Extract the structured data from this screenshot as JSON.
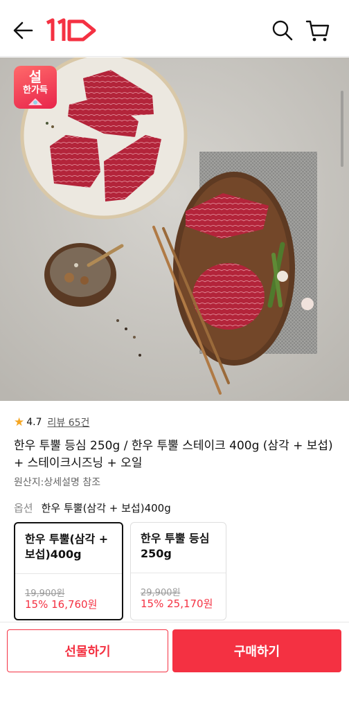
{
  "header": {
    "back_icon": "arrow-left-icon",
    "logo_text": "11",
    "search_icon": "search-icon",
    "cart_icon": "cart-icon",
    "brand_color": "#f43142"
  },
  "product_image": {
    "promo_badge_line1": "설",
    "promo_badge_line2": "한가득"
  },
  "product": {
    "rating": "4.7",
    "review_link": "리뷰 65건",
    "title": "한우 투뿔 등심 250g / 한우 투뿔 스테이크 400g (삼각 + 보섭) + 스테이크시즈닝 + 오일",
    "origin": "원산지:상세설명 참조"
  },
  "options": {
    "label": "옵션",
    "selected_value": "한우 투뿔(삼각 + 보섭)400g",
    "cards": [
      {
        "name": "한우 투뿔(삼각 + 보섭)400g",
        "original_price": "19,900원",
        "sale_price": "15% 16,760원",
        "selected": true
      },
      {
        "name": "한우 투뿔 등심 250g",
        "original_price": "29,900원",
        "sale_price": "15% 25,170원",
        "selected": false
      }
    ]
  },
  "bottom_bar": {
    "gift_label": "선물하기",
    "buy_label": "구매하기"
  }
}
